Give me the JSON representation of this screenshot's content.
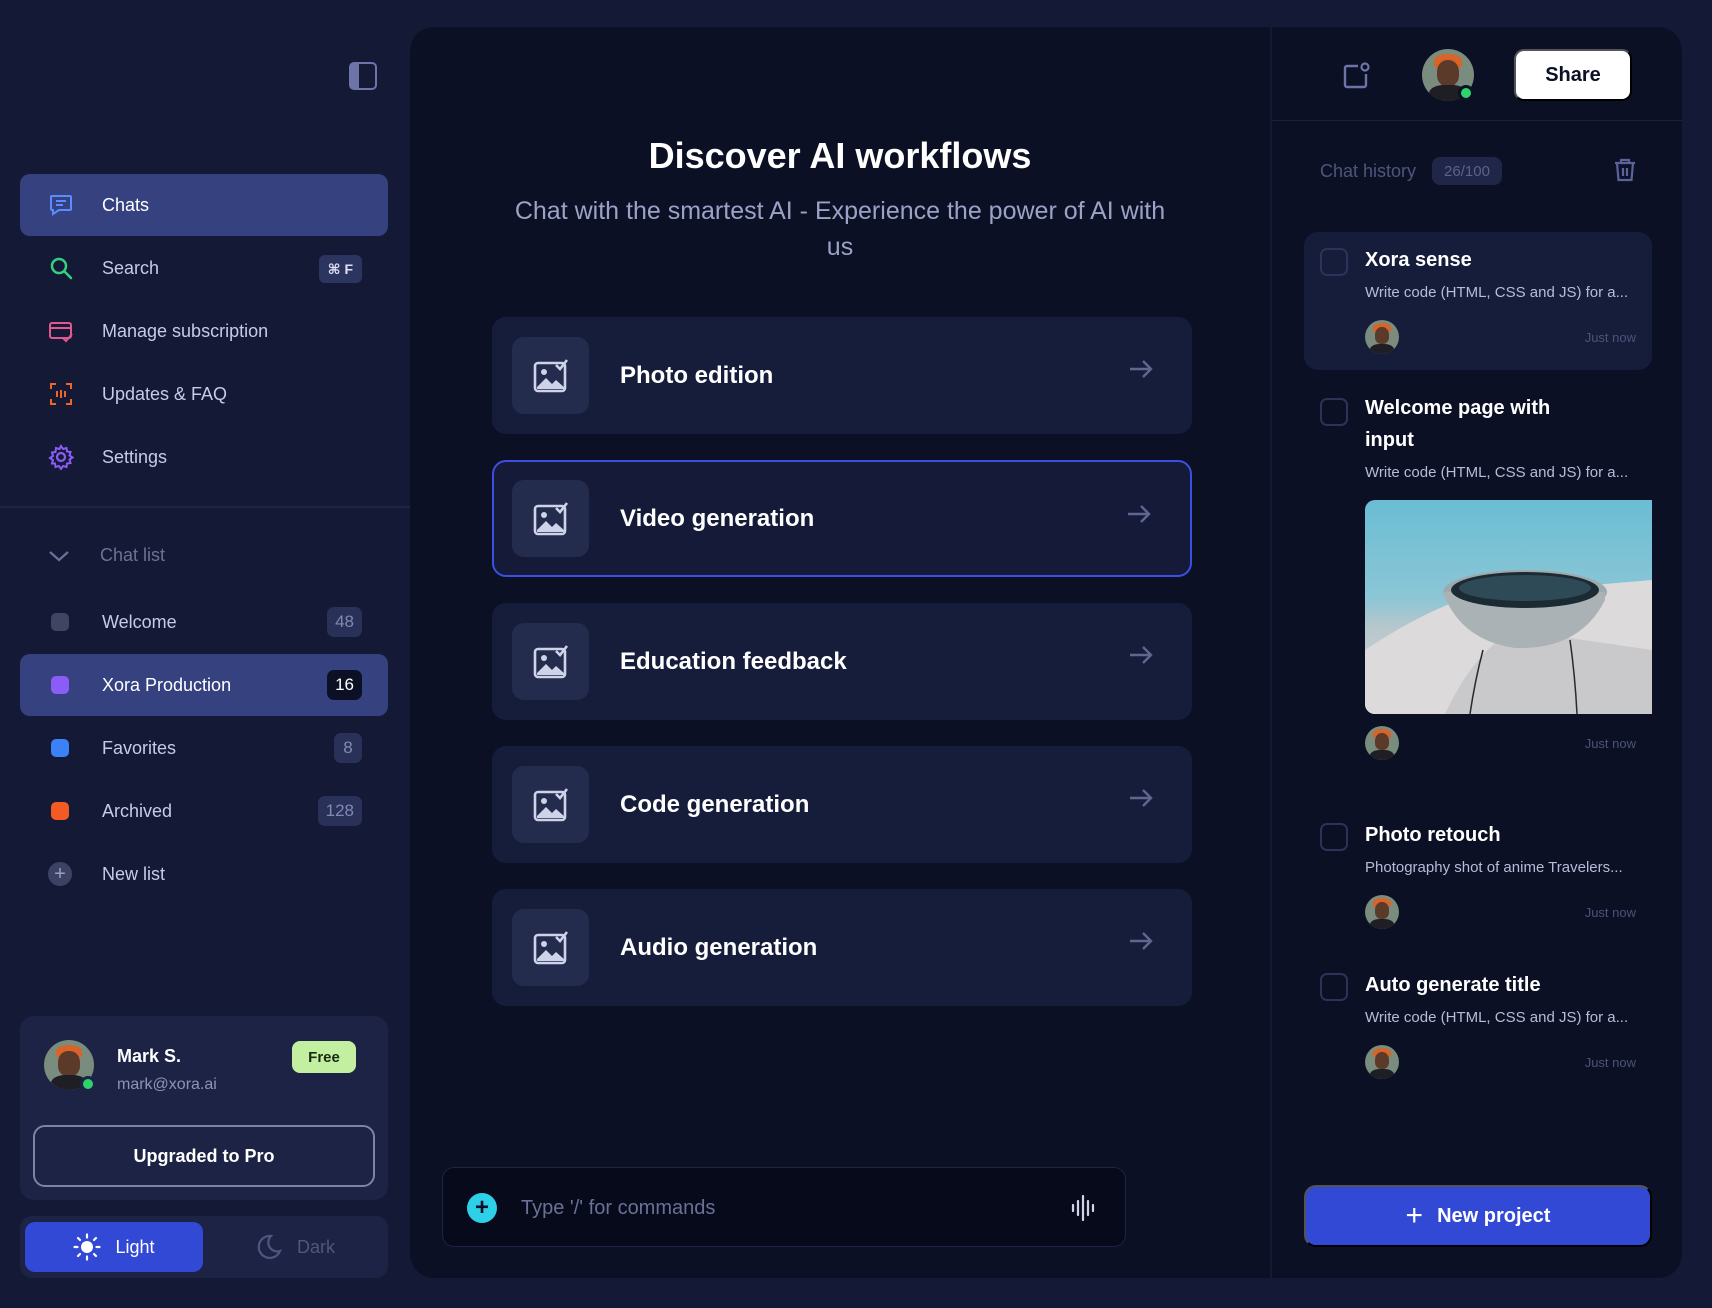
{
  "sidebar": {
    "nav": [
      {
        "label": "Chats",
        "icon": "chat-icon",
        "active": true
      },
      {
        "label": "Search",
        "icon": "search-icon",
        "shortcut": "⌘ F"
      },
      {
        "label": "Manage subscription",
        "icon": "subscription-icon"
      },
      {
        "label": "Updates & FAQ",
        "icon": "updates-icon"
      },
      {
        "label": "Settings",
        "icon": "settings-icon"
      }
    ],
    "chat_list_heading": "Chat list",
    "lists": [
      {
        "label": "Welcome",
        "count": "48",
        "color": "#3f4563"
      },
      {
        "label": "Xora Production",
        "count": "16",
        "color": "#8b5cf6",
        "active": true
      },
      {
        "label": "Favorites",
        "count": "8",
        "color": "#3b82f6"
      },
      {
        "label": "Archived",
        "count": "128",
        "color": "#f35a24"
      }
    ],
    "new_list_label": "New list",
    "user": {
      "name": "Mark S.",
      "email": "mark@xora.ai",
      "plan": "Free"
    },
    "upgrade_label": "Upgraded to Pro",
    "theme": {
      "light": "Light",
      "dark": "Dark",
      "selected": "light"
    }
  },
  "main": {
    "title": "Discover AI workflows",
    "subtitle": "Chat with the smartest AI - Experience the power of AI with us",
    "workflows": [
      {
        "label": "Photo edition"
      },
      {
        "label": "Video generation",
        "selected": true
      },
      {
        "label": "Education feedback"
      },
      {
        "label": "Code generation"
      },
      {
        "label": "Audio generation"
      }
    ],
    "composer": {
      "placeholder": "Type '/' for commands"
    }
  },
  "right": {
    "share_label": "Share",
    "history_label": "Chat history",
    "history_count": "26/100",
    "history": [
      {
        "title": "Xora sense",
        "desc": "Write code (HTML, CSS and JS) for a...",
        "time": "Just now"
      },
      {
        "title": "Welcome page with input",
        "desc": "Write code (HTML, CSS and JS) for a...",
        "time": "Just now"
      },
      {
        "title": "Photo retouch",
        "desc": "Photography shot of anime Travelers...",
        "time": "Just now"
      },
      {
        "title": "Auto generate title",
        "desc": "Write code (HTML, CSS and JS) for a...",
        "time": "Just now"
      }
    ],
    "new_project_label": "New project"
  },
  "colors": {
    "accent": "#3249d6",
    "online": "#2fd36b",
    "free_badge": "#c3f0a0",
    "composer_add": "#2ed0e8"
  }
}
